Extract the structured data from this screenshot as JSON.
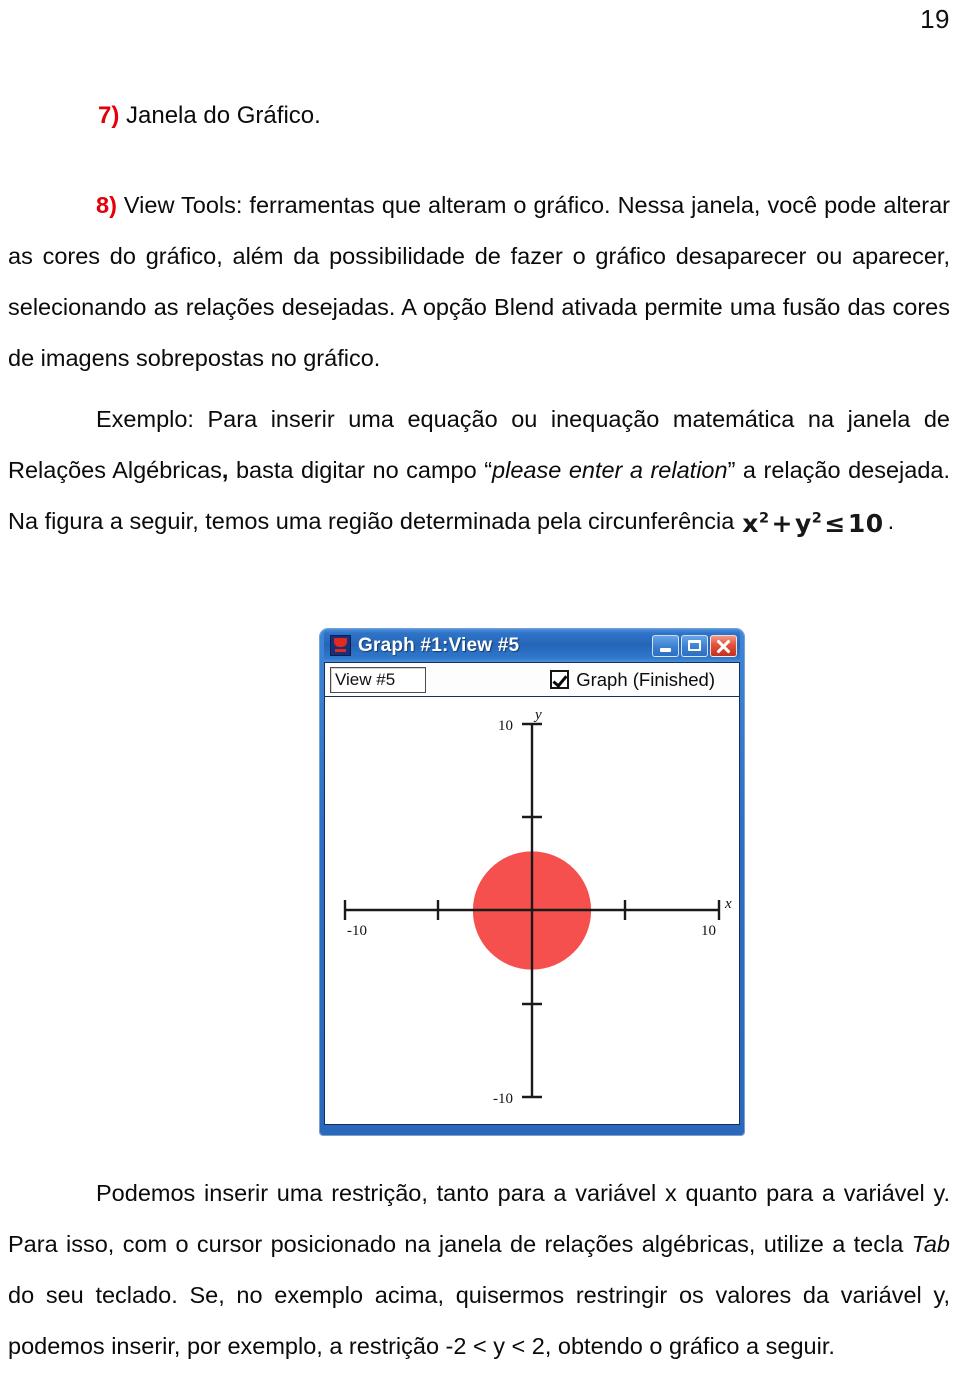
{
  "page": {
    "number": "19"
  },
  "content": {
    "item7": {
      "marker": "7)",
      "text": " Janela do Gráfico."
    },
    "item8": {
      "marker": "8)",
      "text": " View Tools: ferramentas que alteram o gráfico. Nessa janela, você pode alterar as cores do gráfico, além da possibilidade de fazer o gráfico desaparecer ou aparecer, selecionando as relações desejadas. A opção Blend ativada permite uma fusão das cores de imagens sobrepostas no gráfico."
    },
    "example": {
      "part1": "Exemplo: Para inserir uma equação ou inequação matemática na janela de Relações Algébricas",
      "comma": ",",
      "part2": " basta digitar no campo “",
      "field_name": "please enter a relation",
      "part3": "” a relação desejada. Na figura a seguir, temos uma região determinada pela circunferência",
      "formula": {
        "lhs_var1": "x",
        "exp1": "2",
        "plus": "+",
        "lhs_var2": "y",
        "exp2": "2",
        "relation": "≤",
        "rhs": "10"
      },
      "period": "."
    },
    "closing": {
      "part1": "Podemos inserir uma restrição, tanto para a variável x quanto para a variável y. Para isso, com o cursor posicionado na janela de relações algébricas, utilize a tecla ",
      "key": "Tab",
      "part2": " do seu teclado. Se, no exemplo acima, quisermos restringir os valores da variável y, podemos inserir, por exemplo, a restrição -2 < y < 2, obtendo o gráfico a seguir."
    }
  },
  "app_window": {
    "title": "Graph #1:View #5",
    "icon": "graph-app-icon",
    "buttons": {
      "minimize": "minimize-icon",
      "maximize": "maximize-icon",
      "close": "close-icon"
    },
    "toolbar": {
      "view_field_value": "View #5",
      "graph_checkbox_label": "Graph (Finished)",
      "graph_checkbox_checked": true
    }
  },
  "chart_data": {
    "type": "scatter",
    "title": "Graph #1:View #5",
    "xlabel": "x",
    "ylabel": "y",
    "xlim": [
      -10,
      10
    ],
    "ylim": [
      -10,
      10
    ],
    "xticks": [
      -10,
      -5,
      5,
      10
    ],
    "yticks": [
      -10,
      -5,
      5,
      10
    ],
    "xtick_labels": [
      "-10",
      "",
      "",
      "10"
    ],
    "ytick_labels": [
      "-10",
      "",
      "",
      "10"
    ],
    "grid": false,
    "legend": "none",
    "region": {
      "name": "x^2 + y^2 <= 10",
      "shape": "filled-disk",
      "center_x": 0,
      "center_y": 0,
      "radius": 3.162,
      "color": "#f5504e"
    }
  }
}
